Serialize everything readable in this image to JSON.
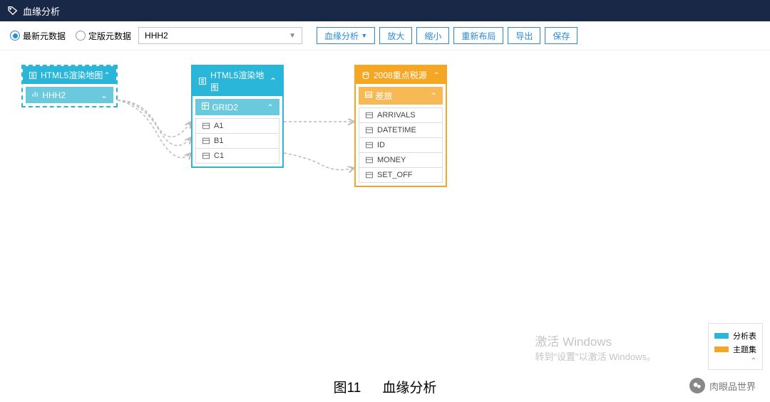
{
  "header": {
    "title": "血缘分析"
  },
  "toolbar": {
    "radio1": "最新元数据",
    "radio2": "定版元数据",
    "dropdown_value": "HHH2",
    "buttons": {
      "analysis": "血缘分析",
      "zoomin": "放大",
      "zoomout": "缩小",
      "relayout": "重新布局",
      "export": "导出",
      "save": "保存"
    }
  },
  "nodes": {
    "left": {
      "title": "HTML5渲染地图",
      "sub": "HHH2"
    },
    "middle": {
      "title": "HTML5渲染地图",
      "sub": "GRID2",
      "rows": [
        "A1",
        "B1",
        "C1"
      ]
    },
    "right": {
      "title": "2008重点税源",
      "sub": "差旅",
      "rows": [
        "ARRIVALS",
        "DATETIME",
        "ID",
        "MONEY",
        "SET_OFF"
      ]
    }
  },
  "watermark": {
    "line1": "激活 Windows",
    "line2": "转到\"设置\"以激活 Windows。"
  },
  "legend": {
    "item1": "分析表",
    "item2": "主题集"
  },
  "wechat": {
    "name": "肉眼品世界"
  },
  "caption": {
    "fig": "图11",
    "text": "血缘分析"
  }
}
